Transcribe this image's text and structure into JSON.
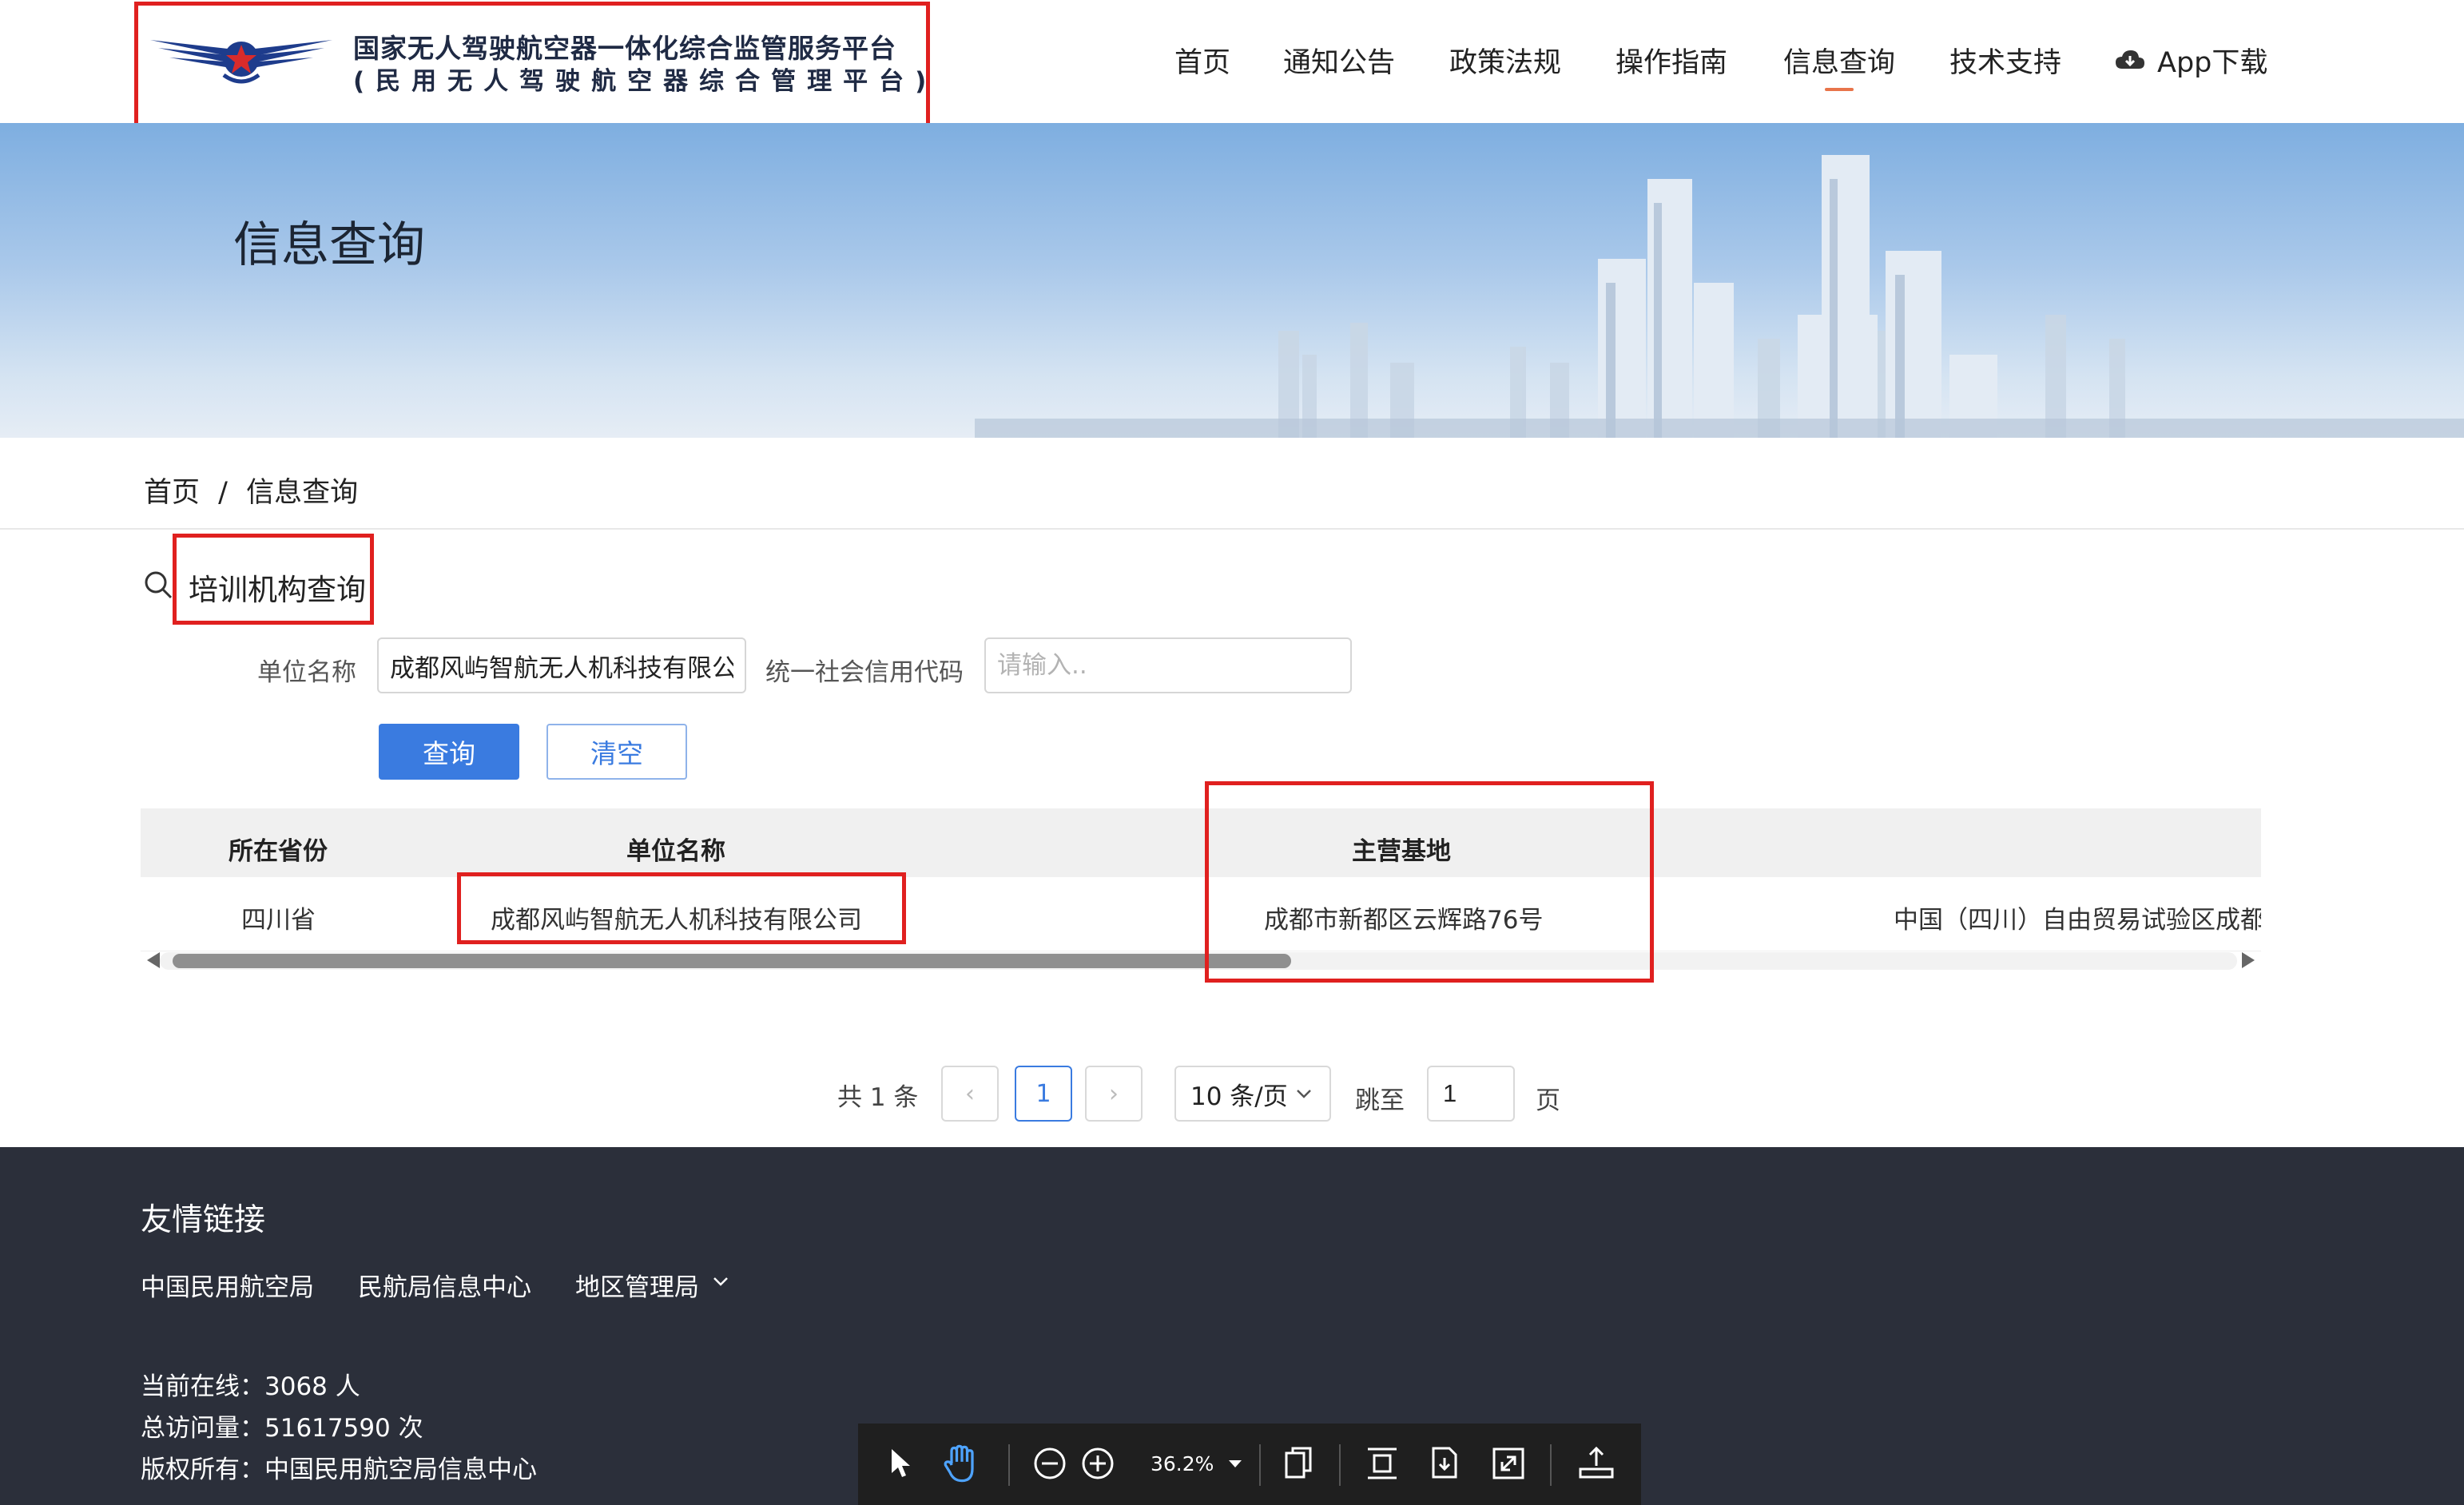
{
  "header": {
    "logo_line1": "国家无人驾驶航空器一体化综合监管服务平台",
    "logo_line2": "(民用无人驾驶航空器综合管理平台)",
    "nav": [
      {
        "label": "首页"
      },
      {
        "label": "通知公告"
      },
      {
        "label": "政策法规"
      },
      {
        "label": "操作指南"
      },
      {
        "label": "信息查询",
        "active": true
      },
      {
        "label": "技术支持"
      },
      {
        "label": "App下载",
        "icon": "cloud-download-icon"
      }
    ]
  },
  "banner": {
    "title": "信息查询"
  },
  "breadcrumb": {
    "home": "首页",
    "separator": "/",
    "current": "信息查询"
  },
  "search": {
    "section_title": "培训机构查询",
    "section_icon": "search-icon",
    "unit_name_label": "单位名称",
    "unit_name_value": "成都风屿智航无人机科技有限公司",
    "credit_code_label": "统一社会信用代码",
    "credit_code_placeholder": "请输入..",
    "query_button": "查询",
    "clear_button": "清空"
  },
  "table": {
    "columns": [
      "所在省份",
      "单位名称",
      "主营基地",
      ""
    ],
    "rows": [
      [
        "四川省",
        "成都风屿智航无人机科技有限公司",
        "成都市新都区云辉路76号",
        "中国（四川）自由贸易试验区成都"
      ]
    ]
  },
  "pagination": {
    "total": "共 1 条",
    "prev": "‹",
    "current_page": "1",
    "next": "›",
    "page_size": "10 条/页",
    "jump_label": "跳至",
    "jump_value": "1",
    "page_suffix": "页"
  },
  "footer": {
    "links_title": "友情链接",
    "links": [
      "中国民用航空局",
      "民航局信息中心",
      "地区管理局"
    ],
    "online": "当前在线：3068 人",
    "visits": "总访问量：51617590 次",
    "copyright": "版权所有：中国民用航空局信息中心"
  },
  "viewer_toolbar": {
    "zoom": "36.2%",
    "icons": [
      "select-arrow-icon",
      "hand-tool-icon",
      "zoom-out-icon",
      "zoom-in-icon",
      "zoom-dropdown-icon",
      "copy-pages-icon",
      "fit-height-icon",
      "fit-page-icon",
      "fullscreen-icon",
      "export-icon"
    ]
  },
  "colors": {
    "accent": "#3a7be0",
    "nav_active_underline": "#e8744a",
    "annotation_red": "#e0201f",
    "footer_bg": "#2b2f3a"
  }
}
